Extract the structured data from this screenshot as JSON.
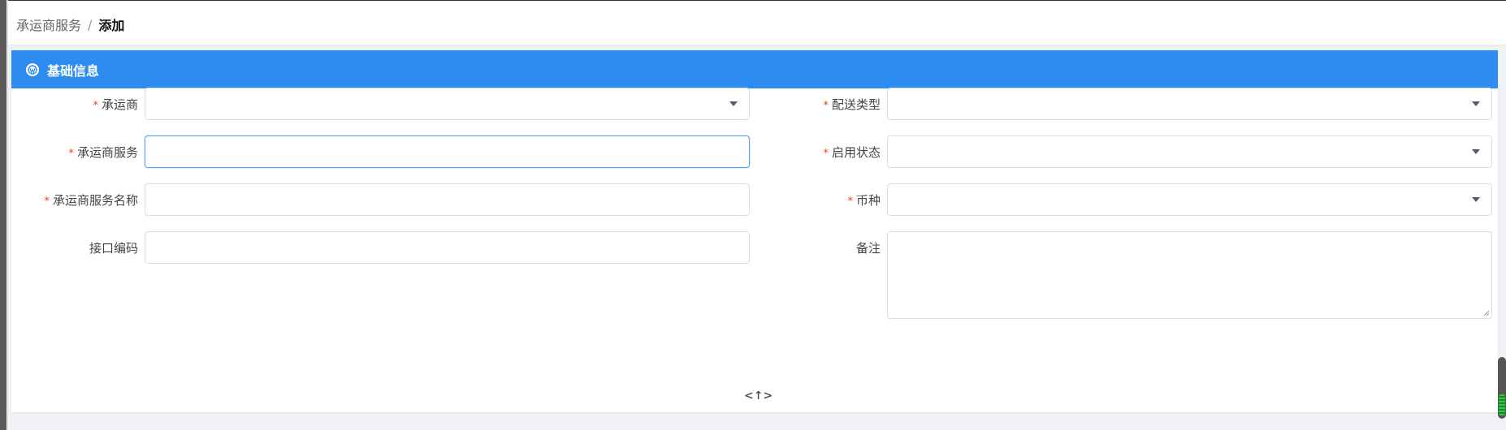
{
  "breadcrumb": {
    "parent": "承运商服务",
    "separator": "/",
    "current": "添加"
  },
  "panel": {
    "title": "基础信息",
    "icon": "wordpress-icon"
  },
  "form": {
    "left": [
      {
        "label": "承运商",
        "required": true,
        "type": "select",
        "value": ""
      },
      {
        "label": "承运商服务",
        "required": true,
        "type": "input",
        "value": ""
      },
      {
        "label": "承运商服务名称",
        "required": true,
        "type": "input",
        "value": ""
      },
      {
        "label": "接口编码",
        "required": false,
        "type": "input",
        "value": ""
      }
    ],
    "right": [
      {
        "label": "配送类型",
        "required": true,
        "type": "select",
        "value": ""
      },
      {
        "label": "启用状态",
        "required": true,
        "type": "select",
        "value": ""
      },
      {
        "label": "币种",
        "required": true,
        "type": "select",
        "value": ""
      },
      {
        "label": "备注",
        "required": false,
        "type": "textarea",
        "value": ""
      }
    ],
    "required_mark": "*"
  },
  "colors": {
    "header_blue": "#2d8cf0",
    "required_red": "#ed4014",
    "focus_border": "#57a3f3"
  }
}
